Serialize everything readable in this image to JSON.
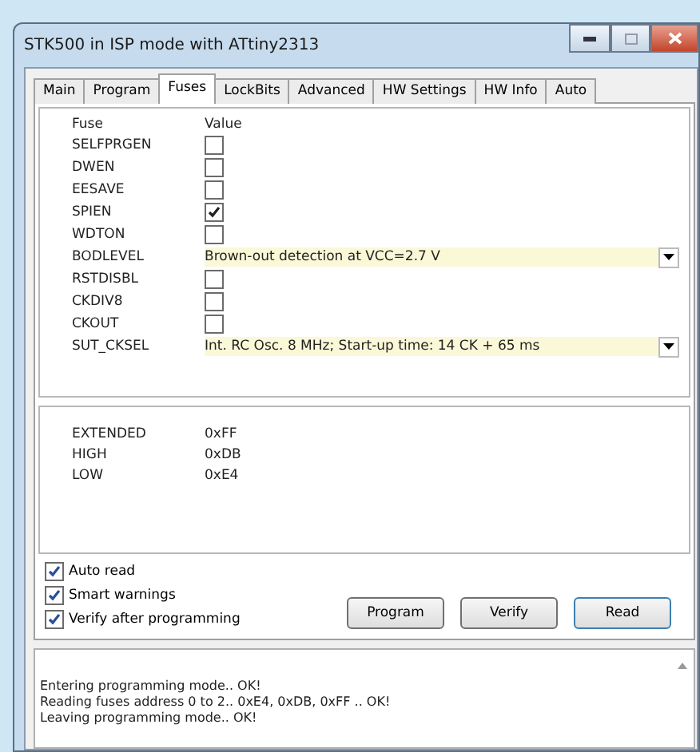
{
  "window": {
    "title": "STK500 in ISP mode with ATtiny2313"
  },
  "tabs": [
    {
      "label": "Main",
      "selected": false
    },
    {
      "label": "Program",
      "selected": false
    },
    {
      "label": "Fuses",
      "selected": true
    },
    {
      "label": "LockBits",
      "selected": false
    },
    {
      "label": "Advanced",
      "selected": false
    },
    {
      "label": "HW Settings",
      "selected": false
    },
    {
      "label": "HW Info",
      "selected": false
    },
    {
      "label": "Auto",
      "selected": false
    }
  ],
  "fuse_table": {
    "columns": [
      "Fuse",
      "Value"
    ],
    "rows": [
      {
        "name": "SELFPRGEN",
        "kind": "checkbox",
        "checked": false
      },
      {
        "name": "DWEN",
        "kind": "checkbox",
        "checked": false
      },
      {
        "name": "EESAVE",
        "kind": "checkbox",
        "checked": false
      },
      {
        "name": "SPIEN",
        "kind": "checkbox",
        "checked": true
      },
      {
        "name": "WDTON",
        "kind": "checkbox",
        "checked": false
      },
      {
        "name": "BODLEVEL",
        "kind": "select",
        "value": "Brown-out detection at VCC=2.7 V"
      },
      {
        "name": "RSTDISBL",
        "kind": "checkbox",
        "checked": false
      },
      {
        "name": "CKDIV8",
        "kind": "checkbox",
        "checked": false
      },
      {
        "name": "CKOUT",
        "kind": "checkbox",
        "checked": false
      },
      {
        "name": "SUT_CKSEL",
        "kind": "select",
        "value": "Int. RC Osc. 8 MHz; Start-up time: 14 CK + 65 ms"
      }
    ]
  },
  "registers": [
    {
      "name": "EXTENDED",
      "value": "0xFF"
    },
    {
      "name": "HIGH",
      "value": "0xDB"
    },
    {
      "name": "LOW",
      "value": "0xE4"
    }
  ],
  "options": [
    {
      "label": "Auto read",
      "checked": true
    },
    {
      "label": "Smart warnings",
      "checked": true
    },
    {
      "label": "Verify after programming",
      "checked": true
    }
  ],
  "buttons": [
    "Program",
    "Verify",
    "Read"
  ],
  "log": [
    "Entering programming mode.. OK!",
    "Reading fuses address 0 to 2.. 0xE4, 0xDB, 0xFF .. OK!",
    "Leaving programming mode.. OK!"
  ]
}
